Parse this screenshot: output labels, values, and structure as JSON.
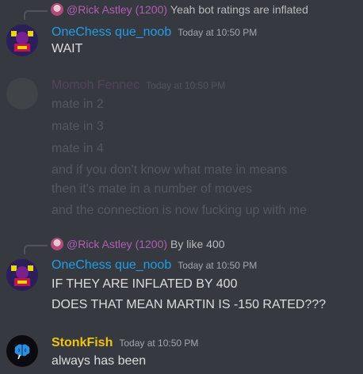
{
  "messages": [
    {
      "reply": {
        "name": "@Rick Astley (1200)",
        "text": "Yeah bot ratings are inflated"
      },
      "author": "OneChess que_noob",
      "timestamp": "Today at 10:50 PM",
      "lines": [
        "WAIT"
      ]
    },
    {
      "author": "Momoh Fennec",
      "timestamp": "Today at 10:50 PM",
      "lines": [
        "mate in 2",
        "mate in 3",
        "mate in 4",
        "and if you don't know what mate in means",
        "then it's mate in a number of moves",
        "and the connection is now fucking up with me"
      ]
    },
    {
      "reply": {
        "name": "@Rick Astley (1200)",
        "text": "By like 400"
      },
      "author": "OneChess que_noob",
      "timestamp": "Today at 10:50 PM",
      "lines": [
        "IF THEY ARE INFLATED BY 400",
        "DOES THAT MEAN MARTIN IS -150 RATED???"
      ]
    },
    {
      "author": "StonkFish",
      "timestamp": "Today at 10:50 PM",
      "lines": [
        "always has been"
      ]
    }
  ]
}
